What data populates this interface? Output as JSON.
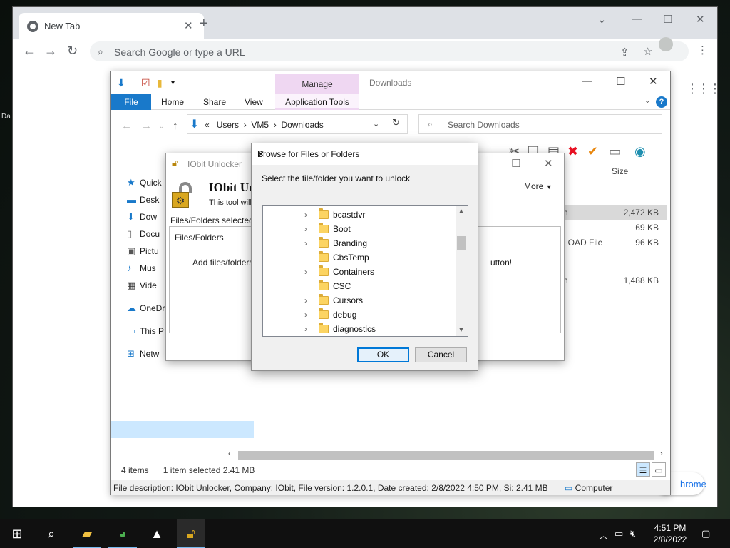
{
  "chrome": {
    "tab_title": "New Tab",
    "omnibox_placeholder": "Search Google or type a URL",
    "customize_label": "hrome"
  },
  "desktop": {
    "fragment": "Da"
  },
  "explorer": {
    "ribbon_context_top": "Manage",
    "window_title": "Downloads",
    "tabs": {
      "file": "File",
      "home": "Home",
      "share": "Share",
      "view": "View",
      "app_tools": "Application Tools"
    },
    "address": {
      "prefix": "«",
      "parts": [
        "Users",
        "VM5",
        "Downloads"
      ]
    },
    "search_placeholder": "Search Downloads",
    "column_size": "Size",
    "nav": {
      "quick": "Quick",
      "desktop": "Desk",
      "downloads": "Dow",
      "documents": "Docu",
      "pictures": "Pictu",
      "music": "Mus",
      "videos": "Vide",
      "onedrive": "OneDr",
      "thispc": "This P",
      "network": "Netw"
    },
    "files": [
      {
        "type": "n",
        "size": "2,472 KB"
      },
      {
        "type": "",
        "size": "69 KB"
      },
      {
        "type": "LOAD File",
        "size": "96 KB"
      },
      {
        "type": "n",
        "size": "1,488 KB"
      }
    ],
    "status": {
      "items": "4 items",
      "selected": "1 item selected  2.41 MB"
    },
    "info_bar": {
      "description": "File description: IObit Unlocker, Company: IObit, File version: 1.2.0.1, Date created: 2/8/2022 4:50 PM, Si: 2.41 MB",
      "computer": "Computer"
    }
  },
  "iobit": {
    "title": "IObit Unlocker",
    "heading": "IObit Ur",
    "description": "This tool will l",
    "more": "More",
    "selected_label": "Files/Folders selected",
    "list_header": "Files/Folders",
    "hint_left": "Add files/folders t",
    "hint_right": "utton!"
  },
  "browse": {
    "title": "Browse for Files or Folders",
    "prompt": "Select the file/folder you want to unlock",
    "items": [
      {
        "name": "bcastdvr",
        "expandable": true
      },
      {
        "name": "Boot",
        "expandable": true
      },
      {
        "name": "Branding",
        "expandable": true
      },
      {
        "name": "CbsTemp",
        "expandable": false
      },
      {
        "name": "Containers",
        "expandable": true
      },
      {
        "name": "CSC",
        "expandable": false
      },
      {
        "name": "Cursors",
        "expandable": true
      },
      {
        "name": "debug",
        "expandable": true
      },
      {
        "name": "diagnostics",
        "expandable": true
      }
    ],
    "ok_label": "OK",
    "cancel_label": "Cancel"
  },
  "taskbar": {
    "time": "4:51 PM",
    "date": "2/8/2022"
  },
  "colors": {
    "accent": "#1979ca",
    "manage": "#efd7f2",
    "folder": "#fcd462",
    "delete_red": "#e81123",
    "check_orange": "#e8860c"
  }
}
